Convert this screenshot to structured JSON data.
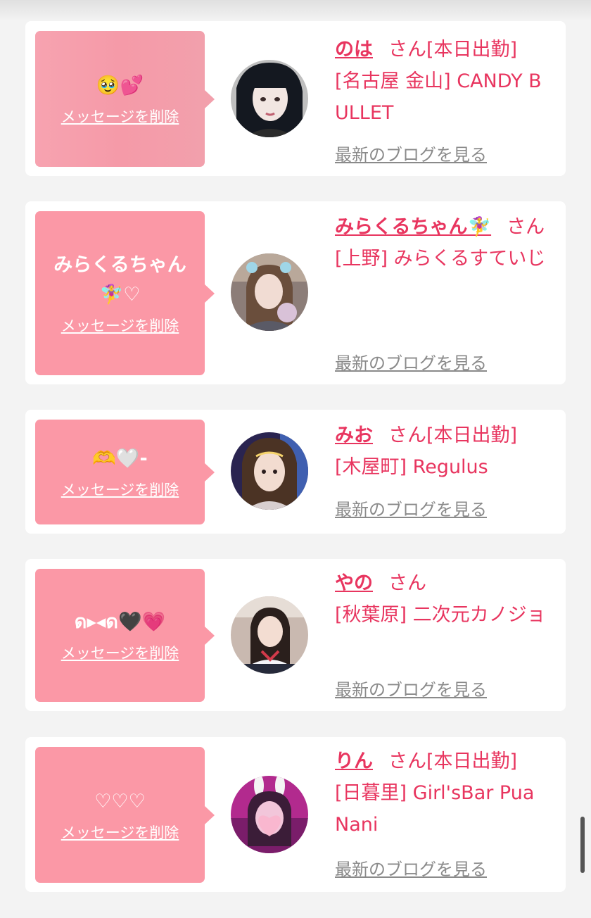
{
  "cards": [
    {
      "message": "🥹💕",
      "delete_label": "メッセージを削除",
      "name": "のは",
      "suffix": "さん",
      "status": "[本日出勤]",
      "shop": "[名古屋 金山] CANDY BULLET",
      "blog_label": "最新のブログを見る",
      "avatar_icon": "avatar-photo-icon"
    },
    {
      "message": "みらくるちゃん🧚‍♀️♡",
      "delete_label": "メッセージを削除",
      "name": "みらくるちゃん🧚‍♀️",
      "suffix": "さん",
      "status": "",
      "shop": "[上野] みらくるすていじ",
      "blog_label": "最新のブログを見る",
      "avatar_icon": "avatar-photo-icon"
    },
    {
      "message": "🫶🤍‐",
      "delete_label": "メッセージを削除",
      "name": "みお",
      "suffix": "さん",
      "status": "[本日出勤]",
      "shop": "[木屋町] Regulus",
      "blog_label": "最新のブログを見る",
      "avatar_icon": "avatar-photo-icon"
    },
    {
      "message": "ด▸◂ด🖤💗",
      "delete_label": "メッセージを削除",
      "name": "やの",
      "suffix": "さん",
      "status": "",
      "shop": "[秋葉原] 二次元カノジョ",
      "blog_label": "最新のブログを見る",
      "avatar_icon": "avatar-photo-icon"
    },
    {
      "message": "♡♡♡",
      "delete_label": "メッセージを削除",
      "name": "りん",
      "suffix": "さん",
      "status": "[本日出勤]",
      "shop": "[日暮里] Girl'sBar Pua Nani",
      "blog_label": "最新のブログを見る",
      "avatar_icon": "avatar-photo-icon"
    }
  ],
  "colors": {
    "accent": "#e8355f",
    "bubble": "#fb98a6",
    "muted": "#8a8a8a"
  }
}
